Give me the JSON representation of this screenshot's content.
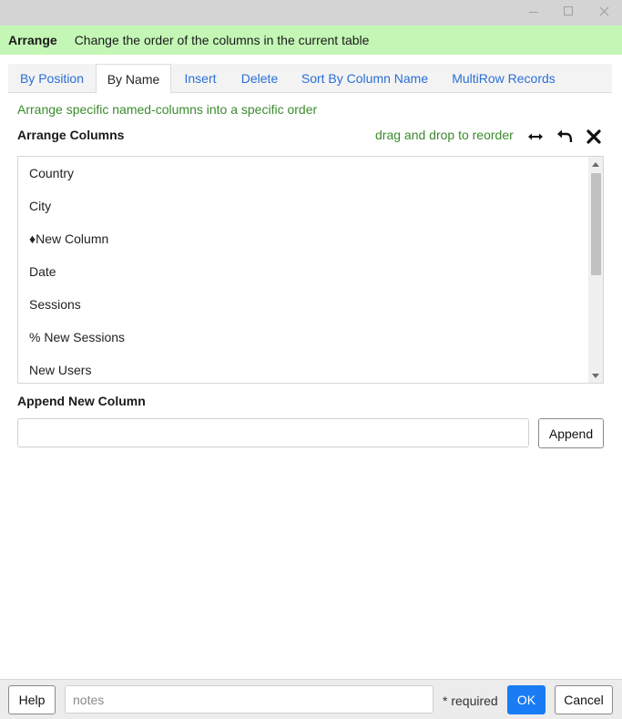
{
  "banner": {
    "title": "Arrange",
    "description": "Change the order of the columns in the current table"
  },
  "tabs": [
    {
      "label": "By Position",
      "active": false
    },
    {
      "label": "By Name",
      "active": true
    },
    {
      "label": "Insert",
      "active": false
    },
    {
      "label": "Delete",
      "active": false
    },
    {
      "label": "Sort By Column Name",
      "active": false
    },
    {
      "label": "MultiRow Records",
      "active": false
    }
  ],
  "panel": {
    "subtitle": "Arrange specific named-columns into a specific order",
    "arrange_label": "Arrange Columns",
    "hint": "drag and drop to reorder",
    "columns": [
      "Country",
      "City",
      "♦New Column",
      "Date",
      "Sessions",
      "% New Sessions",
      "New Users"
    ],
    "append_label": "Append New Column",
    "append_input_value": "",
    "append_button": "Append"
  },
  "footer": {
    "help_button": "Help",
    "notes_placeholder": "notes",
    "required_text": "* required",
    "ok_button": "OK",
    "cancel_button": "Cancel"
  },
  "icons": {
    "minimize": "minimize-icon",
    "maximize": "maximize-icon",
    "close": "close-icon",
    "expand": "expand-width-icon",
    "undo": "undo-icon",
    "clear": "clear-icon"
  },
  "colors": {
    "banner_bg": "#c4f7b6",
    "accent_green": "#3b8b2e",
    "link_blue": "#2a6fd6",
    "ok_blue": "#1a7cf5"
  }
}
